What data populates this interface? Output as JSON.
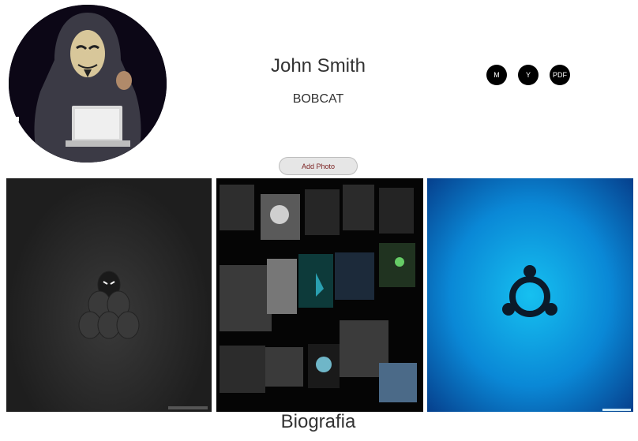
{
  "profile": {
    "name": "John Smith",
    "subtitle": "BOBCAT"
  },
  "social": [
    {
      "label": "M",
      "icon": "m-icon"
    },
    {
      "label": "Y",
      "icon": "y-icon"
    },
    {
      "label": "PDF",
      "icon": "pdf-icon"
    }
  ],
  "actions": {
    "add_photo": "Add Photo"
  },
  "gallery": {
    "slides": [
      "dark-masks-wallpaper",
      "android-icons-collage",
      "ubuntu-logo-wallpaper"
    ],
    "prev_icon": "arrow-left-icon",
    "next_icon": "arrow-right-icon"
  },
  "section": {
    "biography_title": "Biografia"
  },
  "colors": {
    "social_bg": "#000000",
    "ubuntu_blue": "#0a88d6",
    "add_photo_text": "#7a1f1f"
  }
}
